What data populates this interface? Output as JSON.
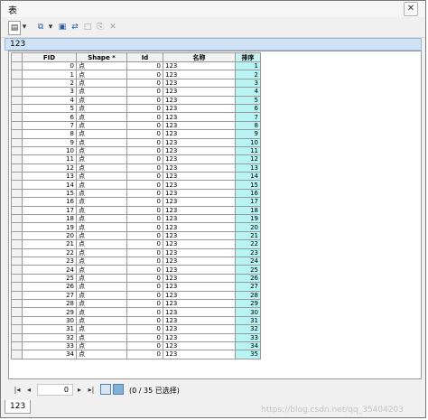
{
  "window": {
    "title": "表",
    "close_glyph": "✕"
  },
  "toolbar": {
    "icons": [
      "table-options-icon",
      "dropdown-arrow-icon",
      "related-tables-icon",
      "select-by-attributes-icon",
      "switch-selection-icon",
      "clear-selection-icon",
      "copy-selection-icon",
      "delete-selection-icon"
    ],
    "glyphs": {
      "table_options": "▤",
      "dropdown": "▾",
      "related": "⧉",
      "select_attr": "▣",
      "switch_sel": "⇄",
      "clear_sel": "□",
      "copy_sel": "⎘",
      "delete_sel": "✕"
    }
  },
  "tab": {
    "label": "123"
  },
  "grid": {
    "columns": [
      "FID",
      "Shape *",
      "Id",
      "名称",
      "排序"
    ],
    "sorted_column_color": "#b8f4f4",
    "rows": [
      {
        "fid": "0",
        "shape": "点",
        "id": "0",
        "name": "123",
        "sort": "1"
      },
      {
        "fid": "1",
        "shape": "点",
        "id": "0",
        "name": "123",
        "sort": "2"
      },
      {
        "fid": "2",
        "shape": "点",
        "id": "0",
        "name": "123",
        "sort": "3"
      },
      {
        "fid": "3",
        "shape": "点",
        "id": "0",
        "name": "123",
        "sort": "4"
      },
      {
        "fid": "4",
        "shape": "点",
        "id": "0",
        "name": "123",
        "sort": "5"
      },
      {
        "fid": "5",
        "shape": "点",
        "id": "0",
        "name": "123",
        "sort": "6"
      },
      {
        "fid": "6",
        "shape": "点",
        "id": "0",
        "name": "123",
        "sort": "7"
      },
      {
        "fid": "7",
        "shape": "点",
        "id": "0",
        "name": "123",
        "sort": "8"
      },
      {
        "fid": "8",
        "shape": "点",
        "id": "0",
        "name": "123",
        "sort": "9"
      },
      {
        "fid": "9",
        "shape": "点",
        "id": "0",
        "name": "123",
        "sort": "10"
      },
      {
        "fid": "10",
        "shape": "点",
        "id": "0",
        "name": "123",
        "sort": "11"
      },
      {
        "fid": "11",
        "shape": "点",
        "id": "0",
        "name": "123",
        "sort": "12"
      },
      {
        "fid": "12",
        "shape": "点",
        "id": "0",
        "name": "123",
        "sort": "13"
      },
      {
        "fid": "13",
        "shape": "点",
        "id": "0",
        "name": "123",
        "sort": "14"
      },
      {
        "fid": "14",
        "shape": "点",
        "id": "0",
        "name": "123",
        "sort": "15"
      },
      {
        "fid": "15",
        "shape": "点",
        "id": "0",
        "name": "123",
        "sort": "16"
      },
      {
        "fid": "16",
        "shape": "点",
        "id": "0",
        "name": "123",
        "sort": "17"
      },
      {
        "fid": "17",
        "shape": "点",
        "id": "0",
        "name": "123",
        "sort": "18"
      },
      {
        "fid": "18",
        "shape": "点",
        "id": "0",
        "name": "123",
        "sort": "19"
      },
      {
        "fid": "19",
        "shape": "点",
        "id": "0",
        "name": "123",
        "sort": "20"
      },
      {
        "fid": "20",
        "shape": "点",
        "id": "0",
        "name": "123",
        "sort": "21"
      },
      {
        "fid": "21",
        "shape": "点",
        "id": "0",
        "name": "123",
        "sort": "22"
      },
      {
        "fid": "22",
        "shape": "点",
        "id": "0",
        "name": "123",
        "sort": "23"
      },
      {
        "fid": "23",
        "shape": "点",
        "id": "0",
        "name": "123",
        "sort": "24"
      },
      {
        "fid": "24",
        "shape": "点",
        "id": "0",
        "name": "123",
        "sort": "25"
      },
      {
        "fid": "25",
        "shape": "点",
        "id": "0",
        "name": "123",
        "sort": "26"
      },
      {
        "fid": "26",
        "shape": "点",
        "id": "0",
        "name": "123",
        "sort": "27"
      },
      {
        "fid": "27",
        "shape": "点",
        "id": "0",
        "name": "123",
        "sort": "28"
      },
      {
        "fid": "28",
        "shape": "点",
        "id": "0",
        "name": "123",
        "sort": "29"
      },
      {
        "fid": "29",
        "shape": "点",
        "id": "0",
        "name": "123",
        "sort": "30"
      },
      {
        "fid": "30",
        "shape": "点",
        "id": "0",
        "name": "123",
        "sort": "31"
      },
      {
        "fid": "31",
        "shape": "点",
        "id": "0",
        "name": "123",
        "sort": "32"
      },
      {
        "fid": "32",
        "shape": "点",
        "id": "0",
        "name": "123",
        "sort": "33"
      },
      {
        "fid": "33",
        "shape": "点",
        "id": "0",
        "name": "123",
        "sort": "34"
      },
      {
        "fid": "34",
        "shape": "点",
        "id": "0",
        "name": "123",
        "sort": "35"
      }
    ]
  },
  "navigation": {
    "first_glyph": "|◂",
    "prev_glyph": "◂",
    "next_glyph": "▸",
    "last_glyph": "▸|",
    "current_record": "0",
    "status": "(0 / 35 已选择)"
  },
  "bottom_tab": {
    "label": "123"
  },
  "watermark": "https://blog.csdn.net/qq_35404203"
}
